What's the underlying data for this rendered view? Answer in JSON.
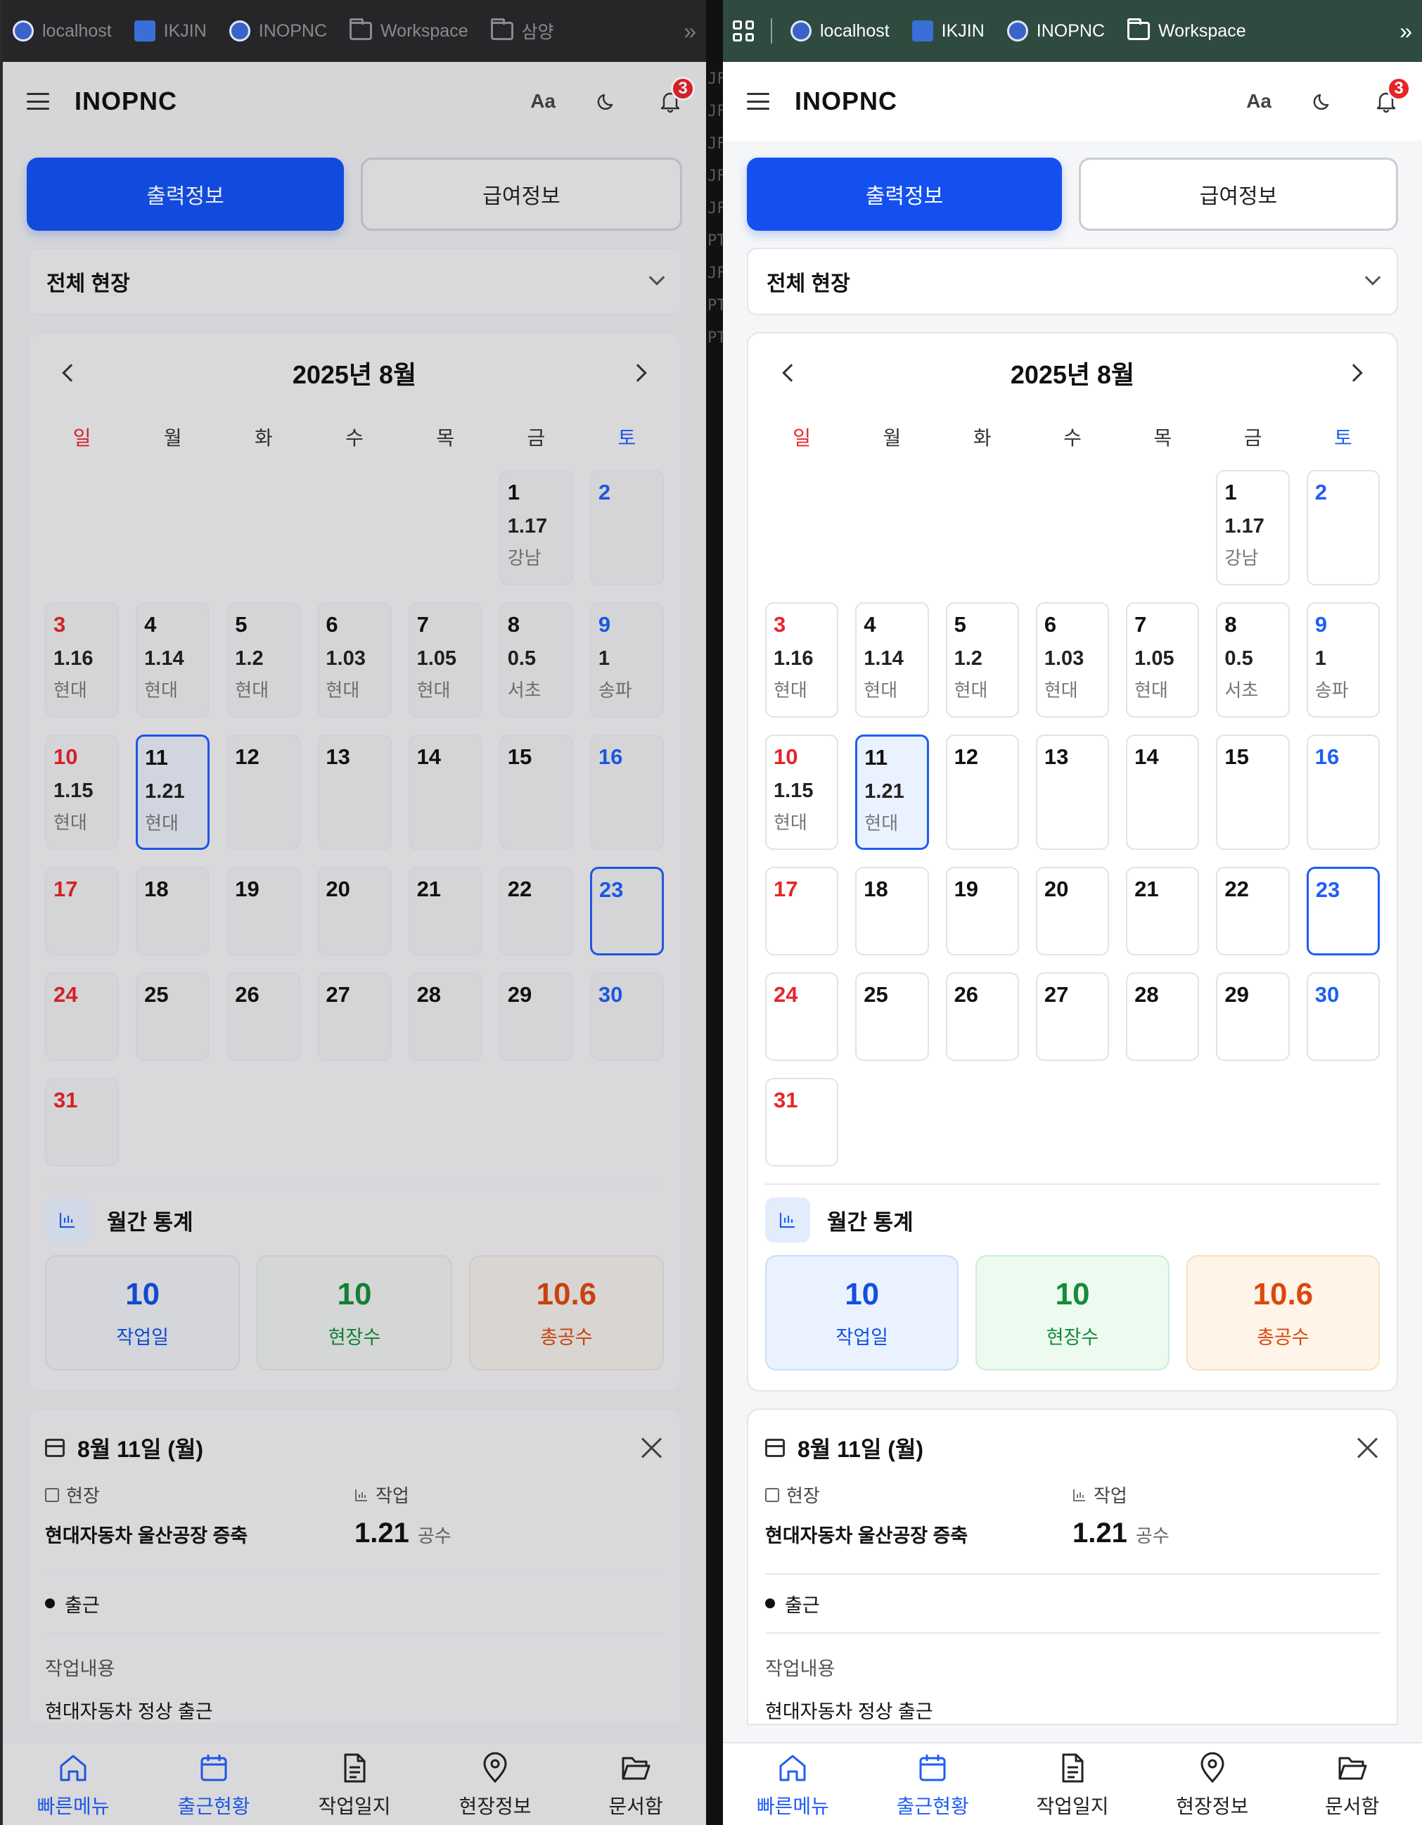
{
  "browser_left": {
    "bookmarks": [
      {
        "icon": "localhost-favicon",
        "label": "localhost"
      },
      {
        "icon": "ikjin-favicon",
        "label": "IKJIN"
      },
      {
        "icon": "inopnc-favicon",
        "label": "INOPNC"
      },
      {
        "icon": "folder-icon",
        "label": "Workspace"
      },
      {
        "icon": "folder-icon",
        "label": "삼양"
      }
    ],
    "more": "»"
  },
  "browser_right": {
    "bookmarks": [
      {
        "icon": "localhost-favicon",
        "label": "localhost"
      },
      {
        "icon": "ikjin-favicon",
        "label": "IKJIN"
      },
      {
        "icon": "inopnc-favicon",
        "label": "INOPNC"
      },
      {
        "icon": "folder-icon",
        "label": "Workspace"
      }
    ],
    "more": "»"
  },
  "header": {
    "brand": "INOPNC",
    "font_toggle": "Aa",
    "notification_count": "3"
  },
  "tabs": {
    "output": "출력정보",
    "salary": "급여정보"
  },
  "site_select": "전체 현장",
  "calendar": {
    "title": "2025년 8월",
    "weekdays": [
      "일",
      "월",
      "화",
      "수",
      "목",
      "금",
      "토"
    ],
    "selected_day": 11,
    "today": 23,
    "days": [
      {
        "d": "1",
        "v": "1.17",
        "s": "강남"
      },
      {
        "d": "2"
      },
      {
        "d": "3",
        "v": "1.16",
        "s": "현대"
      },
      {
        "d": "4",
        "v": "1.14",
        "s": "현대"
      },
      {
        "d": "5",
        "v": "1.2",
        "s": "현대"
      },
      {
        "d": "6",
        "v": "1.03",
        "s": "현대"
      },
      {
        "d": "7",
        "v": "1.05",
        "s": "현대"
      },
      {
        "d": "8",
        "v": "0.5",
        "s": "서초"
      },
      {
        "d": "9",
        "v": "1",
        "s": "송파"
      },
      {
        "d": "10",
        "v": "1.15",
        "s": "현대"
      },
      {
        "d": "11",
        "v": "1.21",
        "s": "현대"
      },
      {
        "d": "12"
      },
      {
        "d": "13"
      },
      {
        "d": "14"
      },
      {
        "d": "15"
      },
      {
        "d": "16"
      },
      {
        "d": "17"
      },
      {
        "d": "18"
      },
      {
        "d": "19"
      },
      {
        "d": "20"
      },
      {
        "d": "21"
      },
      {
        "d": "22"
      },
      {
        "d": "23"
      },
      {
        "d": "24"
      },
      {
        "d": "25"
      },
      {
        "d": "26"
      },
      {
        "d": "27"
      },
      {
        "d": "28"
      },
      {
        "d": "29"
      },
      {
        "d": "30"
      },
      {
        "d": "31"
      }
    ],
    "first_weekday": 5
  },
  "stats": {
    "title": "월간 통계",
    "items": [
      {
        "value": "10",
        "label": "작업일"
      },
      {
        "value": "10",
        "label": "현장수"
      },
      {
        "value": "10.6",
        "label": "총공수"
      }
    ]
  },
  "detail": {
    "date": "8월 11일 (월)",
    "site_label": "현장",
    "site_value": "현대자동차 울산공장 증축",
    "work_label": "작업",
    "work_value": "1.21",
    "work_unit": "공수",
    "status": "출근",
    "content_label": "작업내용",
    "content_value": "현대자동차 정상 출근"
  },
  "bottom_nav": [
    {
      "icon": "home-icon",
      "label": "빠른메뉴",
      "active": true
    },
    {
      "icon": "calendar-icon",
      "label": "출근현황",
      "active": true
    },
    {
      "icon": "document-icon",
      "label": "작업일지",
      "active": false
    },
    {
      "icon": "location-pin-icon",
      "label": "현장정보",
      "active": false
    },
    {
      "icon": "folder-open-icon",
      "label": "문서함",
      "active": false
    }
  ],
  "terminal_fragments": [
    "JF",
    "JF",
    "JF",
    "JF",
    "JF",
    "PT",
    "JF",
    "PT",
    "PT"
  ],
  "colors": {
    "accent": "#1450f0",
    "sunday": "#e5252a",
    "saturday": "#1f5ef5",
    "badge": "#e5252a",
    "workdays": "#1450e0",
    "sites": "#168a3a",
    "total": "#d9480f"
  }
}
